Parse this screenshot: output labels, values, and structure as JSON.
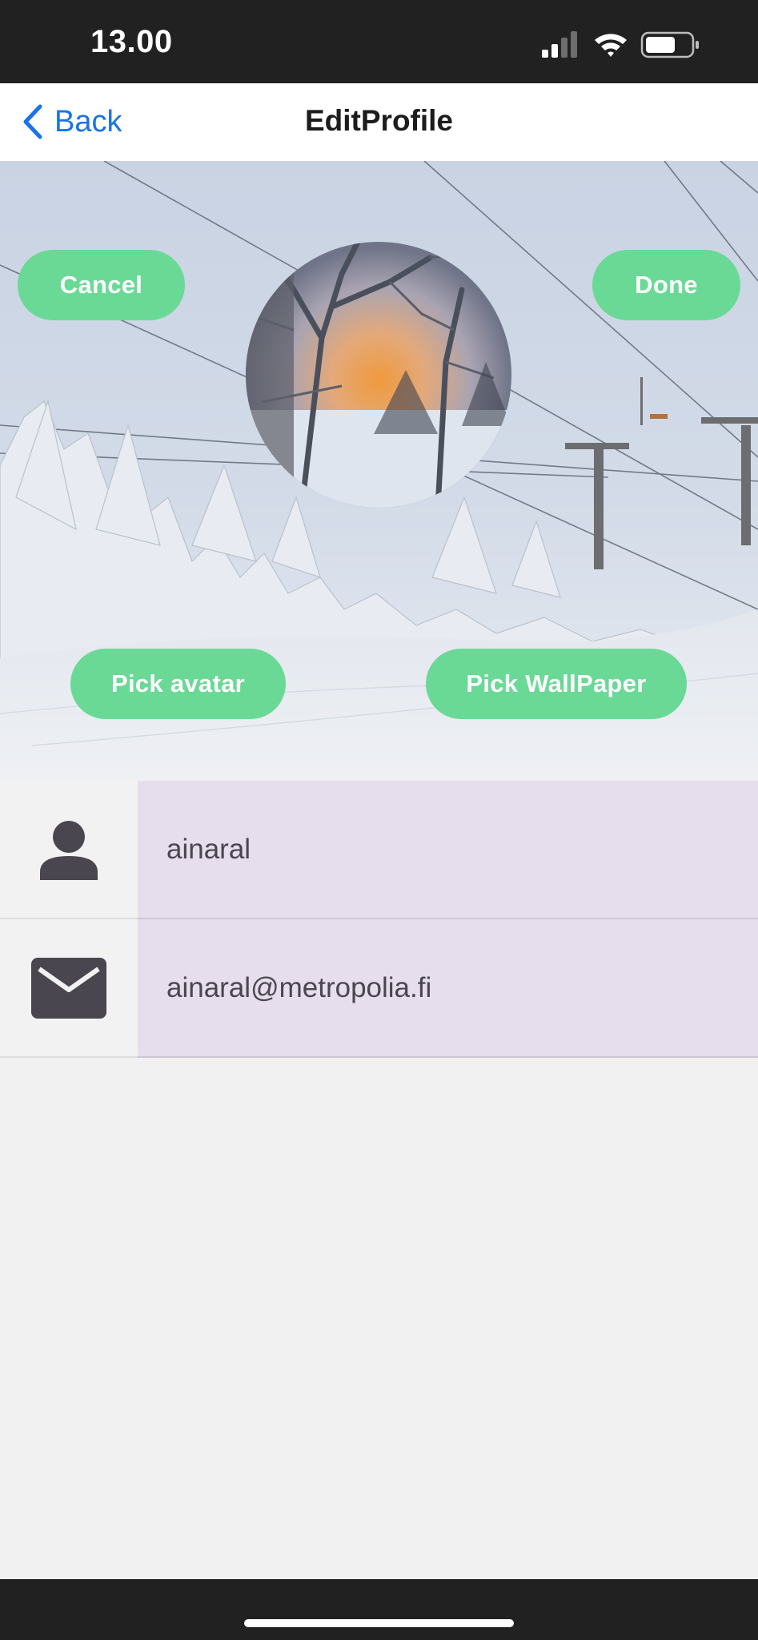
{
  "status_bar": {
    "time": "13.00",
    "icons": [
      "cellular-signal-icon",
      "wifi-icon",
      "battery-icon"
    ]
  },
  "nav": {
    "back_label": "Back",
    "title": "EditProfile"
  },
  "header": {
    "cancel_label": "Cancel",
    "done_label": "Done",
    "pick_avatar_label": "Pick avatar",
    "pick_wallpaper_label": "Pick WallPaper",
    "wallpaper": "snowy-ski-slope-with-lift",
    "avatar": "winter-sunset-through-trees"
  },
  "form": {
    "username": {
      "icon": "person-icon",
      "value": "ainaral"
    },
    "email": {
      "icon": "envelope-icon",
      "value": "ainaral@metropolia.fi"
    }
  },
  "colors": {
    "accent_button": "#6ad996",
    "link": "#1a73e8",
    "input_background": "#e6dded",
    "system_bar": "#212121"
  }
}
